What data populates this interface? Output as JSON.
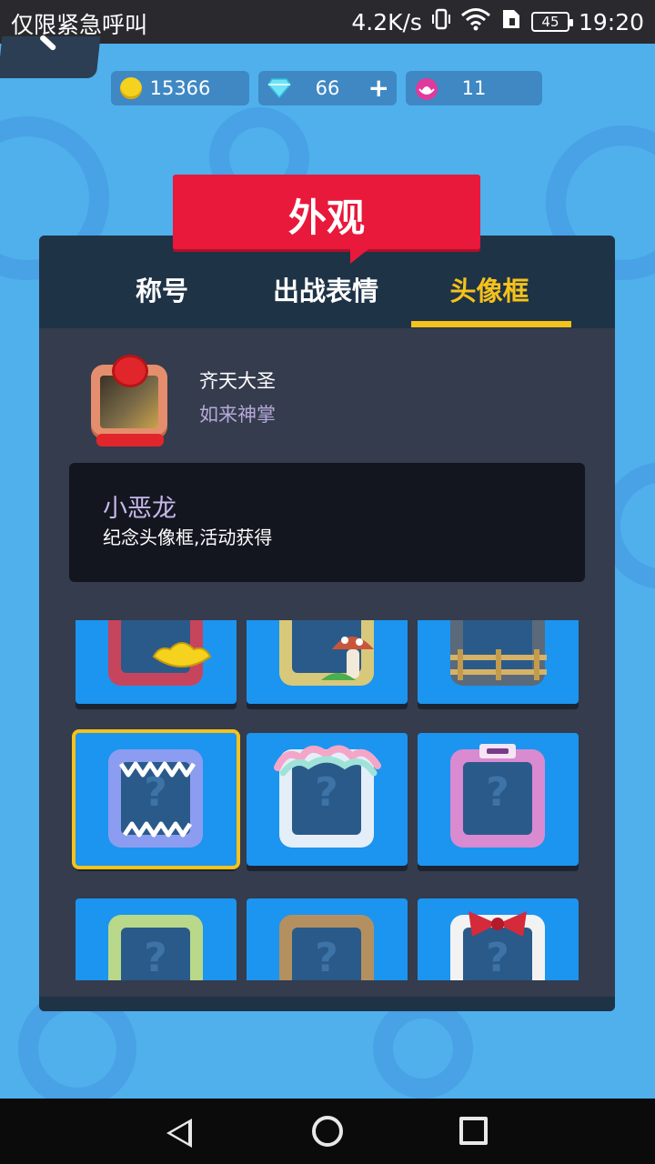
{
  "status_bar": {
    "carrier": "仅限紧急呼叫",
    "speed": "4.2K/s",
    "battery": "45",
    "time": "19:20",
    "icons": [
      "vibrate-icon",
      "wifi-icon",
      "sim-icon",
      "battery-icon"
    ]
  },
  "currency": {
    "coins": "15366",
    "diamonds": "66",
    "lotus": "11",
    "add_label": "+"
  },
  "title": "外观",
  "tabs": [
    {
      "label": "称号",
      "active": false
    },
    {
      "label": "出战表情",
      "active": false
    },
    {
      "label": "头像框",
      "active": true
    }
  ],
  "player": {
    "name": "齐天大圣",
    "title": "如来神掌"
  },
  "selected_frame": {
    "name": "小恶龙",
    "description": "纪念头像框,活动获得"
  },
  "frames": [
    {
      "name": "gold-ingot-frame",
      "color": "#c7455c",
      "selected": false
    },
    {
      "name": "mushroom-frame",
      "color": "#d8c87a",
      "selected": false
    },
    {
      "name": "fence-frame",
      "color": "#5a6a7a",
      "selected": false
    },
    {
      "name": "little-dragon-frame",
      "color": "#8c9cf0",
      "selected": true
    },
    {
      "name": "cloud-frame",
      "color": "#e4eef8",
      "selected": false
    },
    {
      "name": "toy-frame",
      "color": "#d98ad0",
      "selected": false
    },
    {
      "name": "green-moss-frame",
      "color": "#b9d88a",
      "selected": false
    },
    {
      "name": "cookie-frame",
      "color": "#b49060",
      "selected": false
    },
    {
      "name": "bow-frame",
      "color": "#f2f2f2",
      "selected": false
    }
  ],
  "colors": {
    "accent_yellow": "#f6c21b",
    "banner_red": "#e8193b",
    "panel": "#343c4d",
    "tile_blue": "#1b95f0"
  }
}
